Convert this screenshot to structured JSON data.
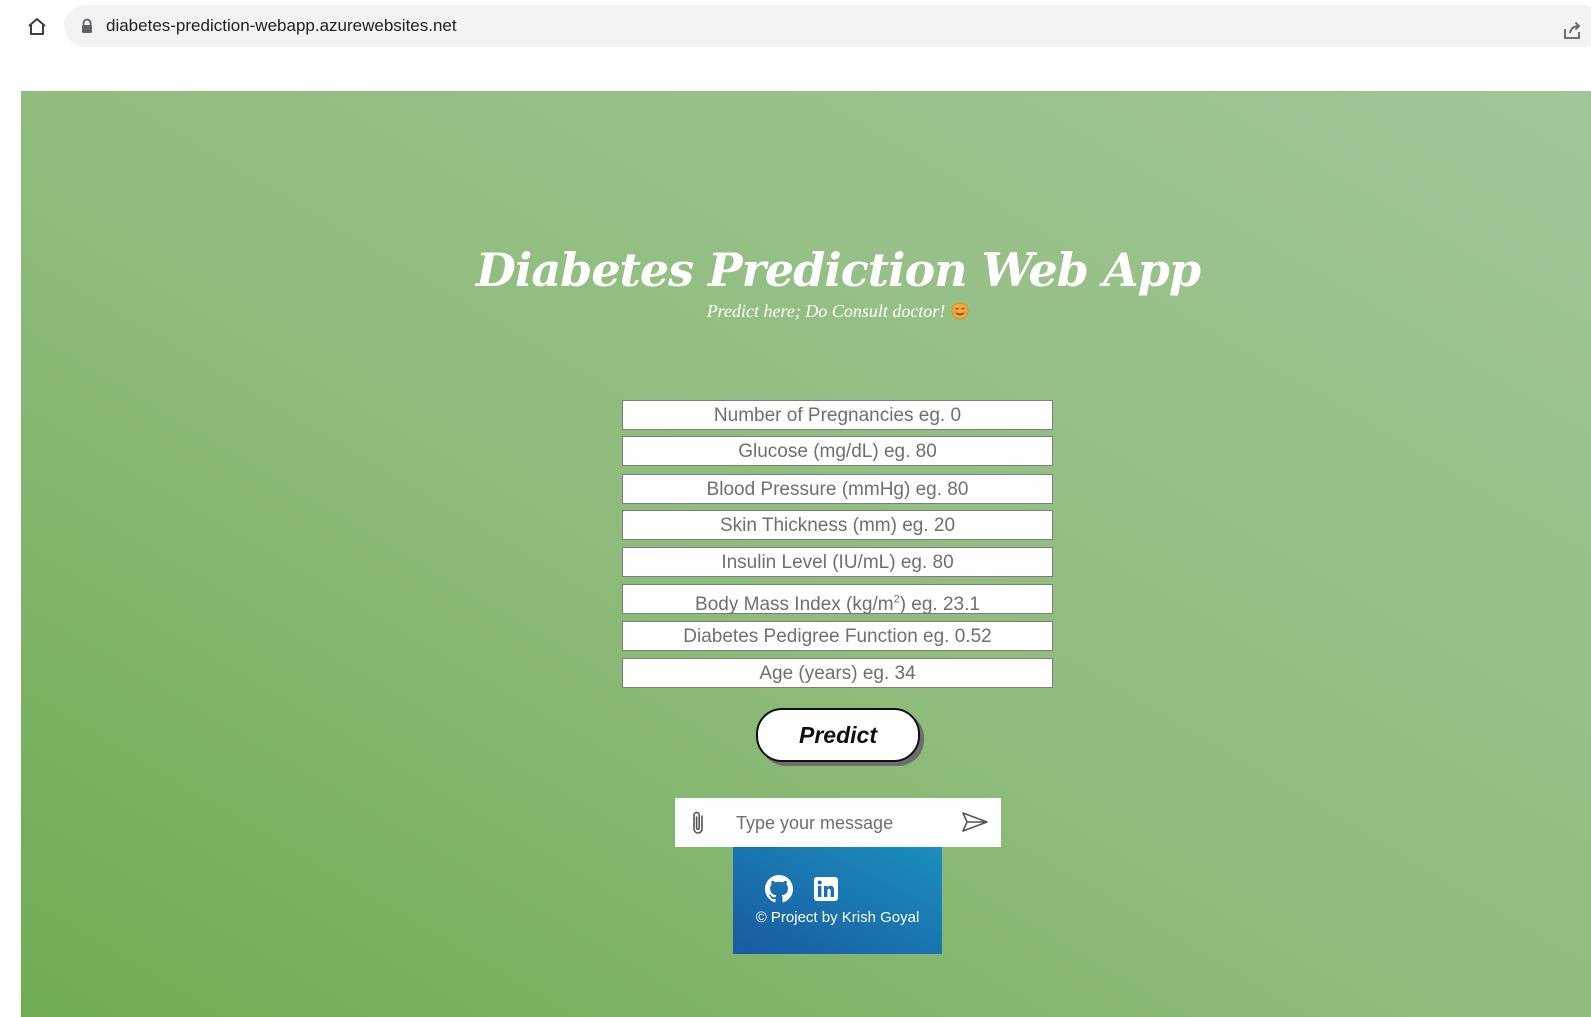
{
  "browser": {
    "url": "diabetes-prediction-webapp.azurewebsites.net"
  },
  "hero": {
    "title": "Diabetes Prediction Web App",
    "subtitle": "Predict here; Do Consult doctor!",
    "subtitle_icon": "smiling-face-icon"
  },
  "form": {
    "fields": [
      {
        "placeholder": "Number of Pregnancies eg. 0",
        "value": ""
      },
      {
        "placeholder": "Glucose (mg/dL) eg. 80",
        "value": ""
      },
      {
        "placeholder": "Blood Pressure (mmHg) eg. 80",
        "value": ""
      },
      {
        "placeholder": "Skin Thickness (mm) eg. 20",
        "value": ""
      },
      {
        "placeholder": "Insulin Level (IU/mL) eg. 80",
        "value": ""
      },
      {
        "placeholder_before": "Body Mass Index (kg/m",
        "placeholder_sup": "2",
        "placeholder_after": ") eg. 23.1",
        "value": ""
      },
      {
        "placeholder": "Diabetes Pedigree Function eg. 0.52",
        "value": ""
      },
      {
        "placeholder": "Age (years) eg. 34",
        "value": ""
      }
    ],
    "predict_label": "Predict"
  },
  "chat": {
    "placeholder": "Type your message",
    "attach_icon": "paperclip-icon",
    "send_icon": "send-icon"
  },
  "footer": {
    "icons": [
      "github-icon",
      "linkedin-icon"
    ],
    "copyright": "© Project by Krish Goyal"
  },
  "colors": {
    "page_gradient_start": "#6fab52",
    "page_gradient_end": "#a1c697",
    "footer_gradient_start": "#1a5aa0",
    "footer_gradient_end": "#1a8fbe",
    "field_text": "#6f6f6f"
  }
}
